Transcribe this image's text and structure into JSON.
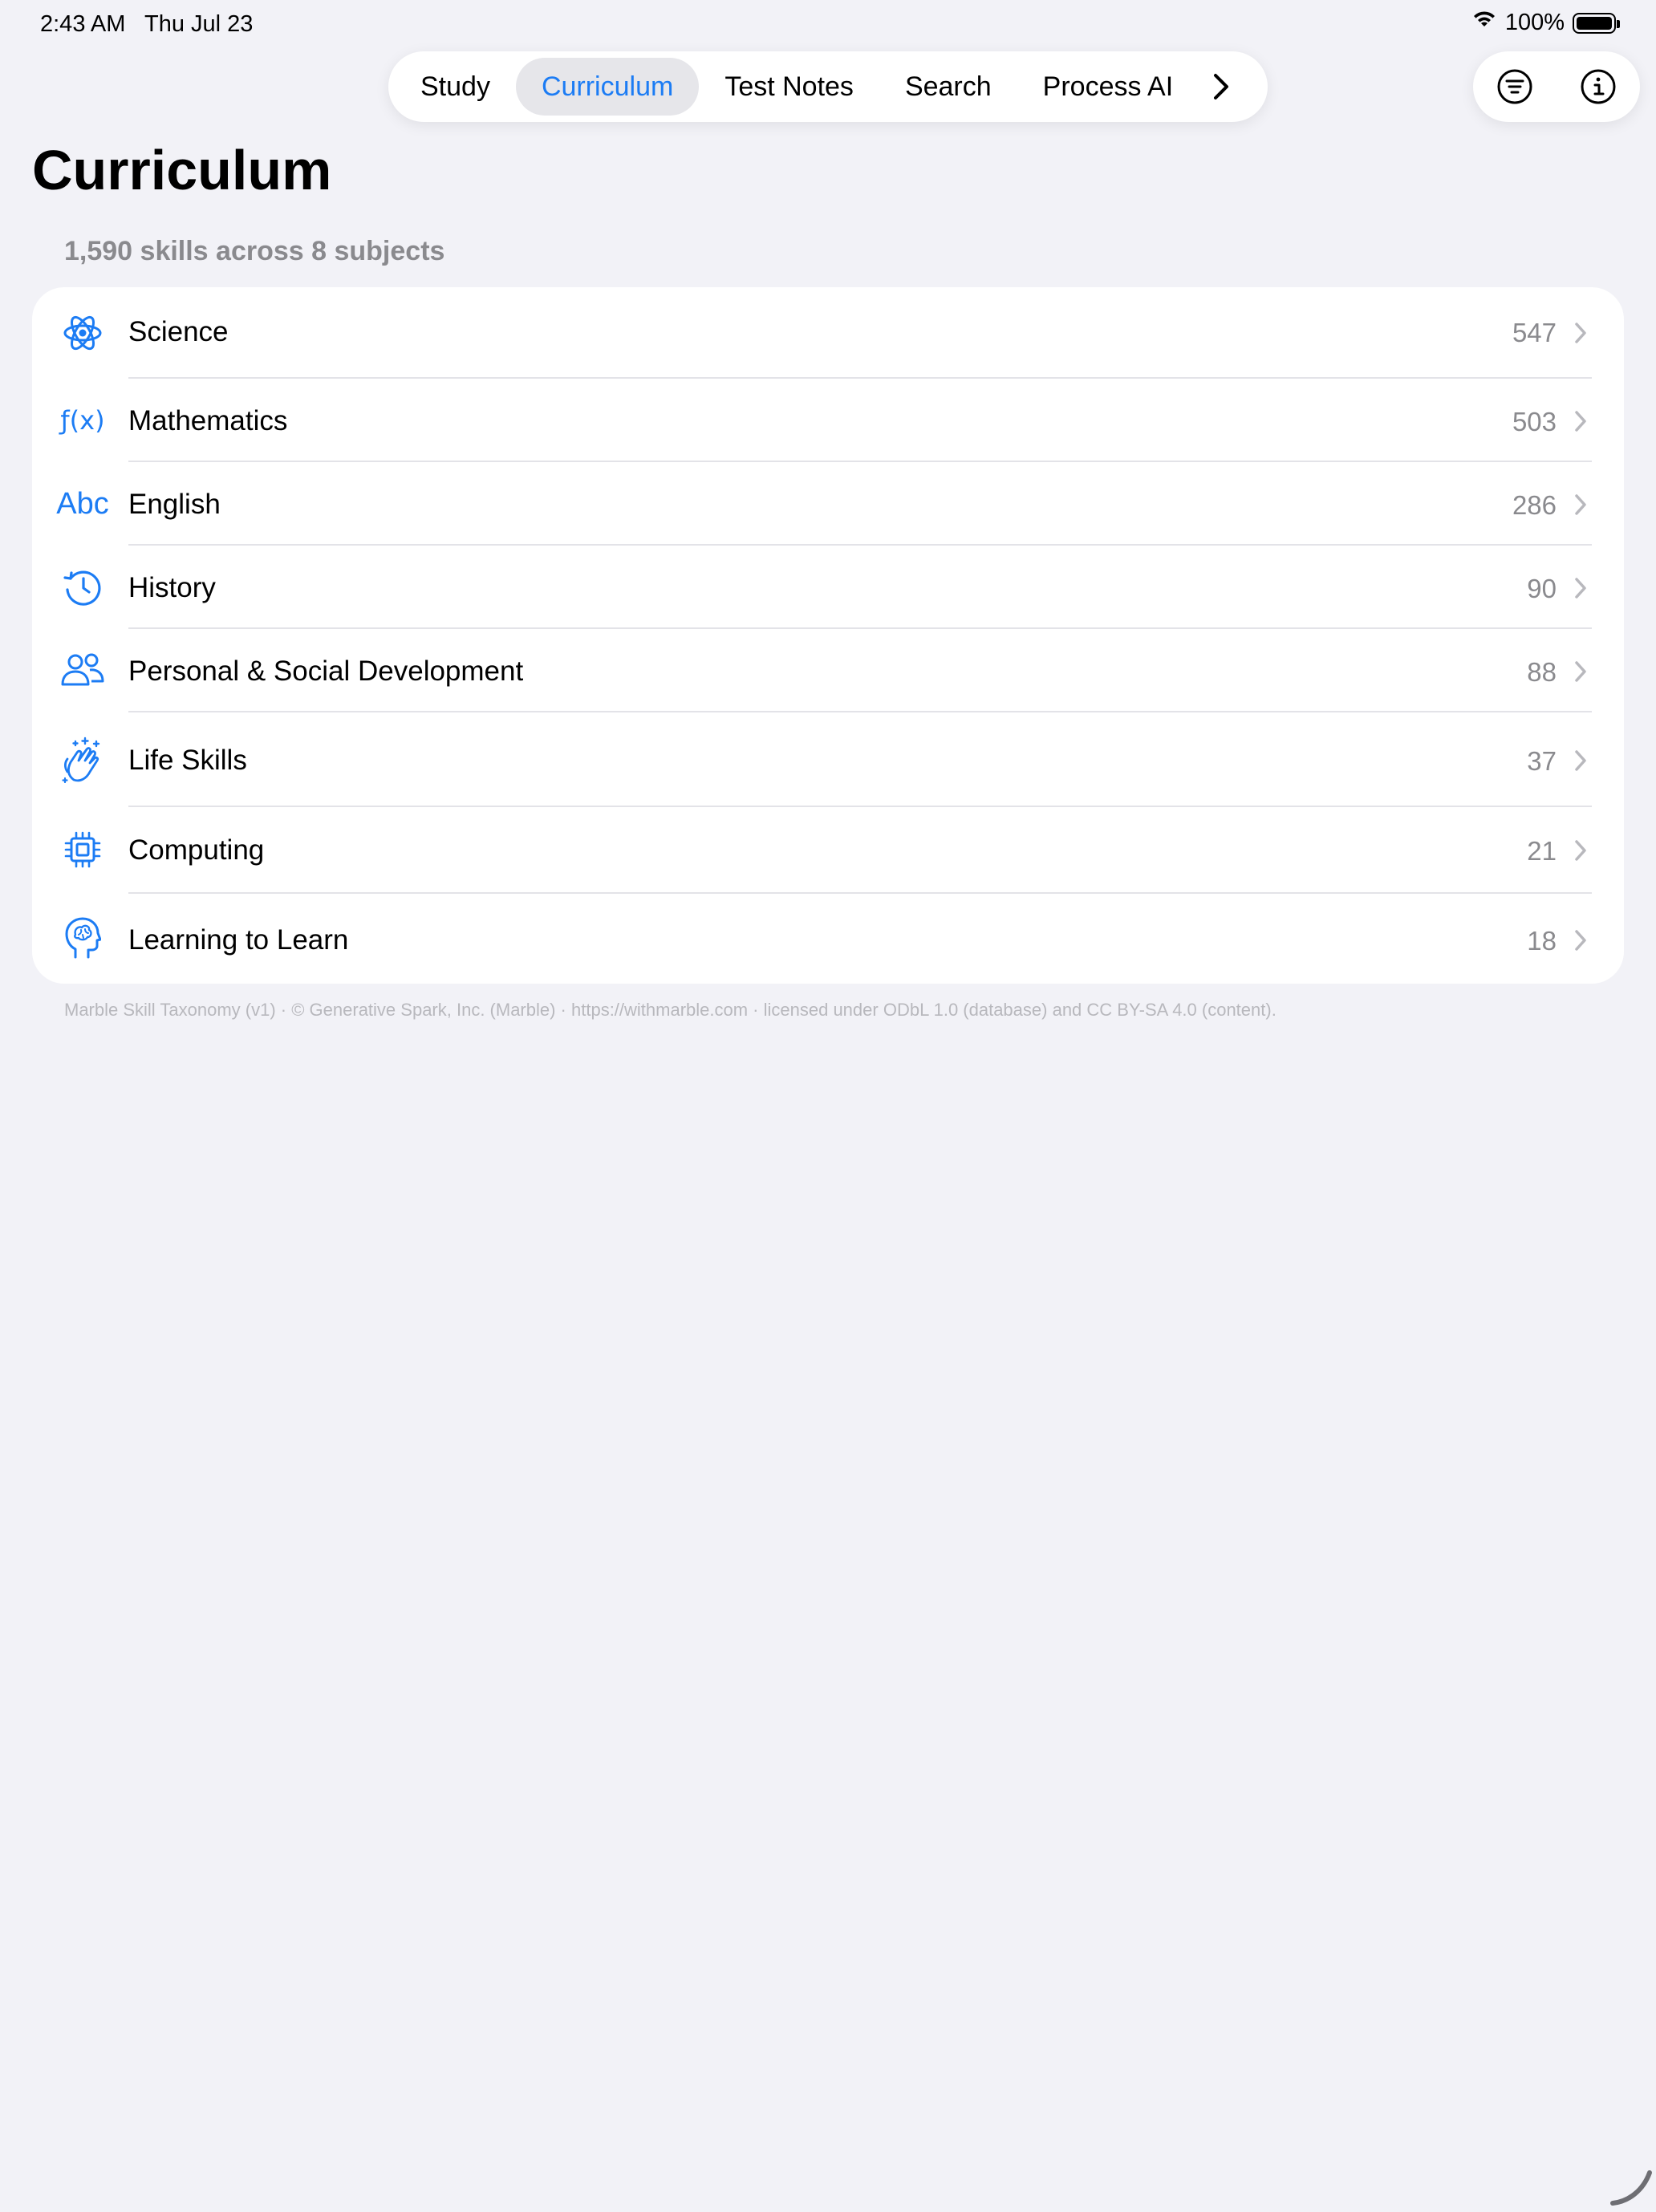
{
  "status": {
    "time": "2:43 AM",
    "date": "Thu Jul 23",
    "battery": "100%"
  },
  "tabs": [
    {
      "label": "Study",
      "active": false
    },
    {
      "label": "Curriculum",
      "active": true
    },
    {
      "label": "Test Notes",
      "active": false
    },
    {
      "label": "Search",
      "active": false
    },
    {
      "label": "Process AI",
      "active": false
    }
  ],
  "toolbar_icons": [
    "filter-icon",
    "info-icon"
  ],
  "page": {
    "title": "Curriculum",
    "subtitle": "1,590 skills across 8 subjects"
  },
  "subjects": [
    {
      "label": "Science",
      "count": "547",
      "icon": "atom-icon"
    },
    {
      "label": "Mathematics",
      "count": "503",
      "icon": "function-icon"
    },
    {
      "label": "English",
      "count": "286",
      "icon": "abc-icon"
    },
    {
      "label": "History",
      "count": "90",
      "icon": "clock-history-icon"
    },
    {
      "label": "Personal & Social Development",
      "count": "88",
      "icon": "people-icon"
    },
    {
      "label": "Life Skills",
      "count": "37",
      "icon": "hands-clap-icon"
    },
    {
      "label": "Computing",
      "count": "21",
      "icon": "cpu-icon"
    },
    {
      "label": "Learning to Learn",
      "count": "18",
      "icon": "brain-head-icon"
    }
  ],
  "icon_labels": {
    "abc": "Abc",
    "function": "ƒ(x)"
  },
  "footer": "Marble Skill Taxonomy (v1) · © Generative Spark, Inc. (Marble) · https://withmarble.com · licensed under ODbL 1.0 (database) and CC BY-SA 4.0 (content).",
  "colors": {
    "accent": "#1c7cf4",
    "background": "#f2f2f7",
    "secondary_text": "#8a8a8e"
  }
}
